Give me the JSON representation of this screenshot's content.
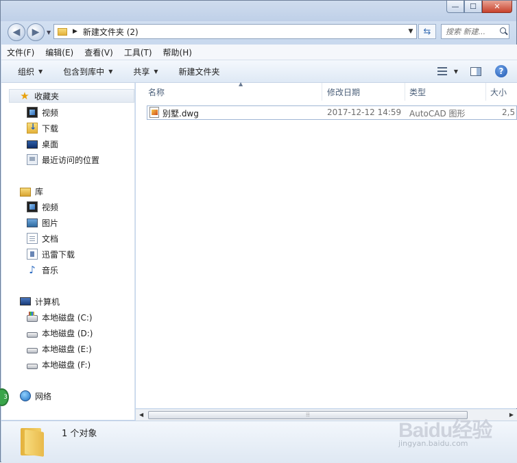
{
  "window": {
    "buttons": {
      "minimize": "—",
      "maximize": "☐",
      "close": "✕"
    }
  },
  "address": {
    "path": "新建文件夹 (2)",
    "search_placeholder": "搜索 新建..."
  },
  "menu": [
    "文件(F)",
    "编辑(E)",
    "查看(V)",
    "工具(T)",
    "帮助(H)"
  ],
  "toolbar": {
    "organize": "组织",
    "include_in_library": "包含到库中",
    "share": "共享",
    "new_folder": "新建文件夹"
  },
  "nav": {
    "favorites": {
      "title": "收藏夹",
      "items": [
        "视频",
        "下载",
        "桌面",
        "最近访问的位置"
      ]
    },
    "libraries": {
      "title": "库",
      "items": [
        "视频",
        "图片",
        "文档",
        "迅雷下载",
        "音乐"
      ]
    },
    "computer": {
      "title": "计算机",
      "items": [
        "本地磁盘 (C:)",
        "本地磁盘 (D:)",
        "本地磁盘 (E:)",
        "本地磁盘 (F:)"
      ]
    },
    "network": {
      "title": "网络"
    }
  },
  "columns": [
    "名称",
    "修改日期",
    "类型",
    "大小"
  ],
  "files": [
    {
      "name": "别墅.dwg",
      "modified": "2017-12-12 14:59",
      "type": "AutoCAD 图形",
      "size": "2,5"
    }
  ],
  "status": {
    "count_text": "1 个对象"
  },
  "watermark": {
    "logo": "Baidu经验",
    "sub": "jingyan.baidu.com"
  },
  "colors": {
    "accent": "#3a6fb5",
    "titlebar": "#c9d9ee",
    "close": "#c8422c"
  }
}
